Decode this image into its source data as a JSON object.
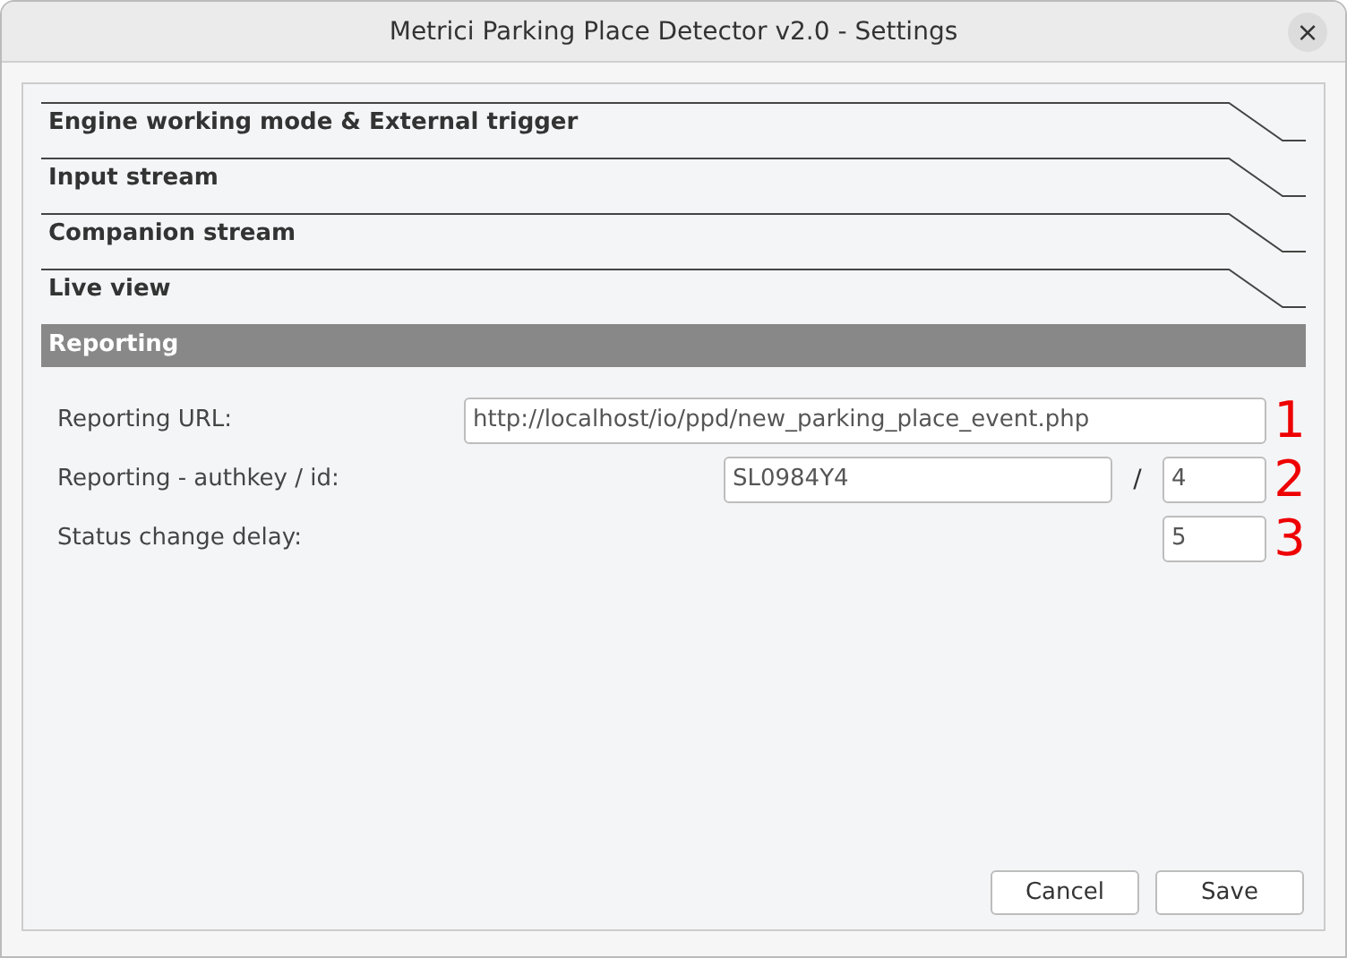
{
  "window": {
    "title": "Metrici Parking Place Detector v2.0 - Settings",
    "close": "×"
  },
  "sections": [
    {
      "title": "Engine working mode & External trigger",
      "expanded": false
    },
    {
      "title": "Input stream",
      "expanded": false
    },
    {
      "title": "Companion stream",
      "expanded": false
    },
    {
      "title": "Live view",
      "expanded": false
    },
    {
      "title": "Reporting",
      "expanded": true
    }
  ],
  "reporting": {
    "rows": [
      {
        "label": "Reporting URL:",
        "kind": "url",
        "value": "http://localhost/io/ppd/new_parking_place_event.php",
        "marker": "1"
      },
      {
        "label": "Reporting - authkey / id:",
        "kind": "pair",
        "value": "SL0984Y4",
        "separator": "/",
        "value_2": "4",
        "marker": "2"
      },
      {
        "label": "Status change delay:",
        "kind": "short",
        "value": "5",
        "marker": "3"
      }
    ]
  },
  "buttons": [
    "Cancel",
    "Save"
  ]
}
